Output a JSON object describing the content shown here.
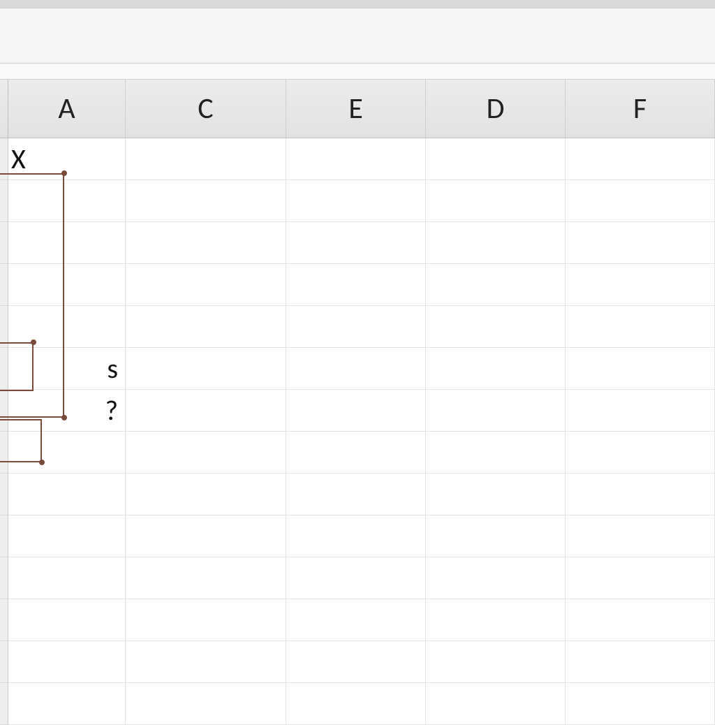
{
  "columns": {
    "A": "A",
    "C": "C",
    "E": "E",
    "D": "D",
    "F": "F"
  },
  "cells": {
    "A1": "X",
    "A6": "s",
    "A7": "?"
  }
}
